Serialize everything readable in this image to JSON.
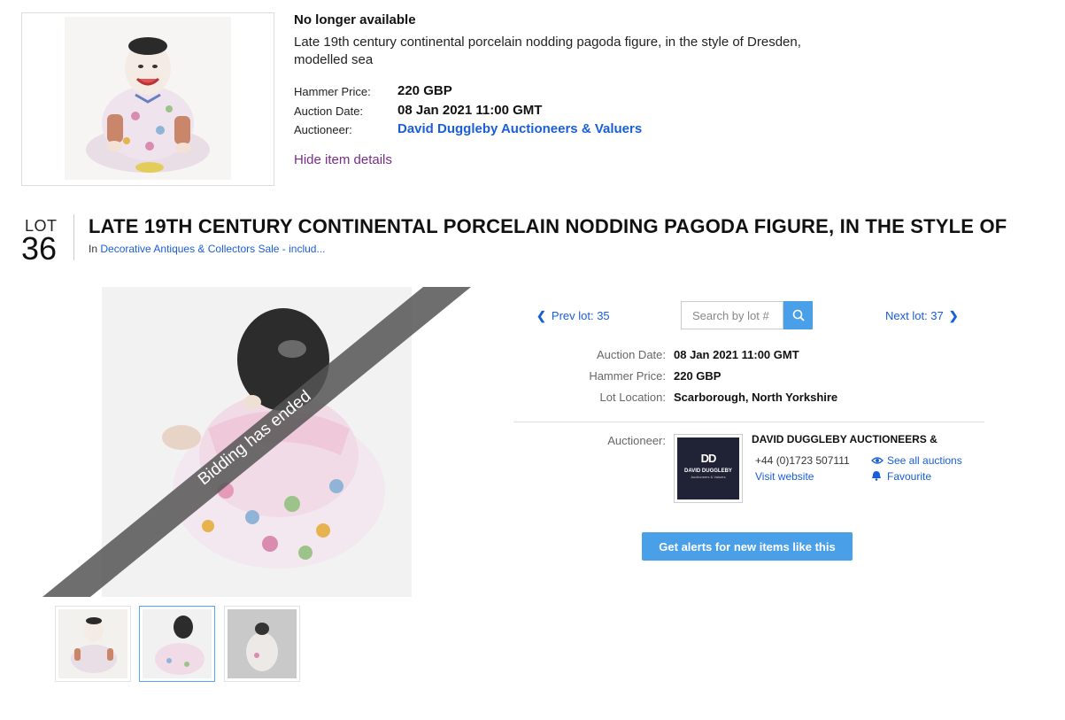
{
  "summary": {
    "status": "No longer available",
    "description": "Late 19th century continental porcelain nodding pagoda figure, in the style of Dresden, modelled sea",
    "hammer_label": "Hammer Price:",
    "hammer_value": "220 GBP",
    "date_label": "Auction Date:",
    "date_value": "08 Jan 2021 11:00 GMT",
    "auctioneer_label": "Auctioneer:",
    "auctioneer_value": "David Duggleby Auctioneers & Valuers",
    "hide_link": "Hide item details"
  },
  "lot": {
    "word": "LOT",
    "number": "36",
    "title": "LATE 19TH CENTURY CONTINENTAL PORCELAIN NODDING PAGODA FIGURE, IN THE STYLE OF",
    "in_prefix": "In",
    "sale_link": "Decorative Antiques & Collectors Sale - includ..."
  },
  "gallery": {
    "banner": "Bidding has ended",
    "thumbnails": [
      "thumb-front",
      "thumb-back",
      "thumb-base"
    ],
    "selected_index": 1
  },
  "nav": {
    "prev": "Prev lot: 35",
    "next": "Next lot: 37",
    "search_placeholder": "Search by lot #"
  },
  "details": {
    "auction_date_label": "Auction Date:",
    "auction_date_value": "08 Jan 2021 11:00 GMT",
    "hammer_label": "Hammer Price:",
    "hammer_value": "220 GBP",
    "location_label": "Lot Location:",
    "location_value": "Scarborough, North Yorkshire"
  },
  "auctioneer": {
    "label": "Auctioneer:",
    "name": "DAVID DUGGLEBY AUCTIONEERS &",
    "phone": "+44 (0)1723 507111",
    "visit_website": "Visit website",
    "see_all": "See all auctions",
    "favourite": "Favourite",
    "logo_text": "DAVID DUGGLEBY",
    "logo_sub": "Auctioneers & Valuers"
  },
  "alert_button": "Get alerts for new items like this",
  "colors": {
    "link": "#1a5ed8",
    "visited": "#7a2c8c",
    "button": "#4a9fe9",
    "banner": "#555555"
  }
}
